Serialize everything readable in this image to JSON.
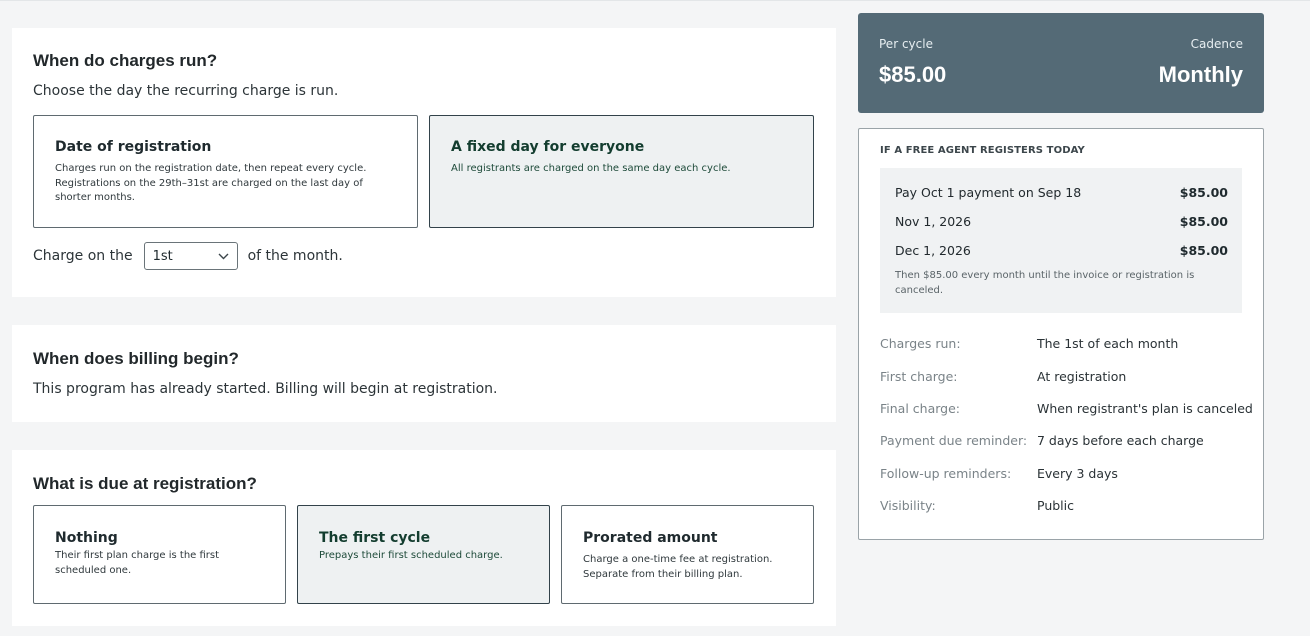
{
  "charges_run": {
    "title": "When do charges run?",
    "subtitle": "Choose the day the recurring charge is run.",
    "options": [
      {
        "title": "Date of registration",
        "desc": "Charges run on the registration date, then repeat every cycle. Registrations on the 29th–31st are charged on the last day of shorter months.",
        "selected": false
      },
      {
        "title": "A fixed day for everyone",
        "desc": "All registrants are charged on the same day each cycle.",
        "selected": true
      }
    ],
    "charge_on_prefix": "Charge on the",
    "charge_day": "1st",
    "charge_on_suffix": "of the month."
  },
  "billing_begin": {
    "title": "When does billing begin?",
    "text": "This program has already started. Billing will begin at registration."
  },
  "due_at_registration": {
    "title": "What is due at registration?",
    "options": [
      {
        "title": "Nothing",
        "desc": "Their first plan charge is the first scheduled one.",
        "selected": false
      },
      {
        "title": "The first cycle",
        "desc": "Prepays their first scheduled charge.",
        "selected": true
      },
      {
        "title": "Prorated amount",
        "desc": "Charge a one-time fee at registration. Separate from their billing plan.",
        "selected": false
      }
    ]
  },
  "summary": {
    "per_cycle_label": "Per cycle",
    "per_cycle_value": "$85.00",
    "cadence_label": "Cadence",
    "cadence_value": "Monthly",
    "bg_color": "#546a76"
  },
  "details": {
    "heading": "IF A FREE AGENT REGISTERS TODAY",
    "schedule": [
      {
        "label": "Pay Oct 1 payment on Sep 18",
        "amount": "$85.00"
      },
      {
        "label": "Nov 1, 2026",
        "amount": "$85.00"
      },
      {
        "label": "Dec 1, 2026",
        "amount": "$85.00"
      }
    ],
    "schedule_note": "Then $85.00 every month until the invoice or registration is canceled.",
    "info": [
      {
        "key": "Charges run:",
        "value": "The 1st of each month"
      },
      {
        "key": "First charge:",
        "value": "At registration"
      },
      {
        "key": "Final charge:",
        "value": "When registrant's plan is canceled"
      },
      {
        "key": "Payment due reminder:",
        "value": "7 days before each charge"
      },
      {
        "key": "Follow-up reminders:",
        "value": "Every 3 days"
      },
      {
        "key": "Visibility:",
        "value": "Public"
      }
    ]
  }
}
